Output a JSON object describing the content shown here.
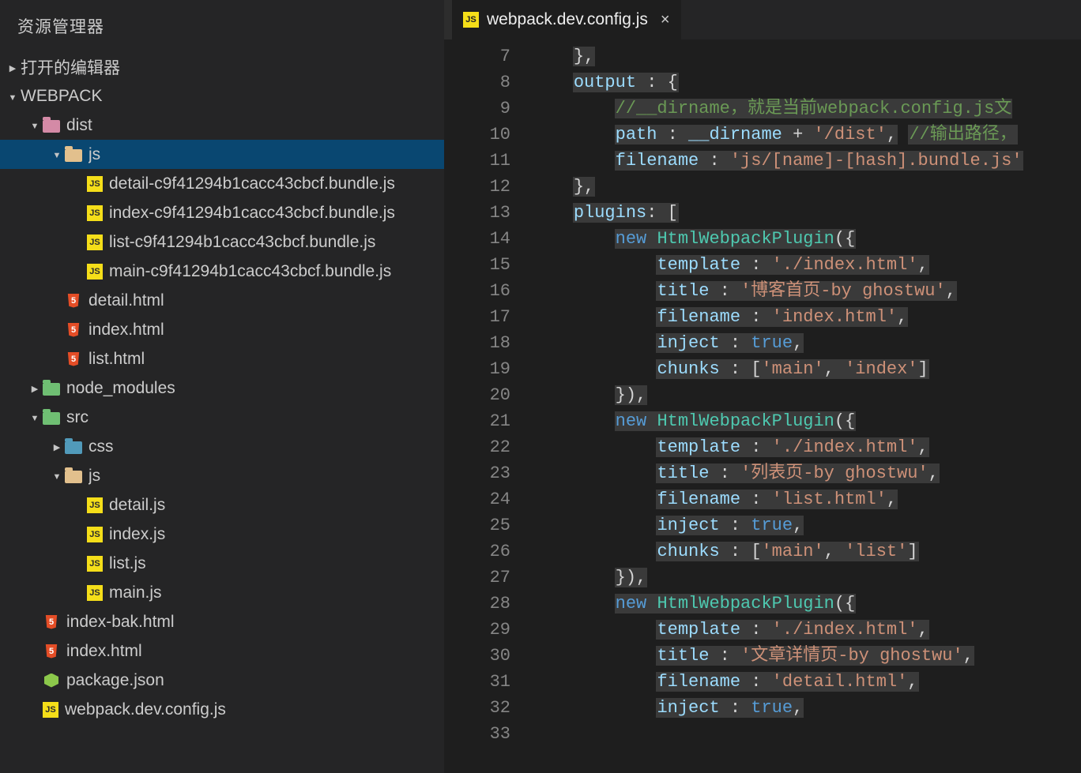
{
  "explorer": {
    "title": "资源管理器",
    "open_editors": "打开的编辑器",
    "project_name": "WEBPACK"
  },
  "tree": [
    {
      "depth": 1,
      "arrow": "expanded",
      "icon": "folder-pink",
      "label": "dist"
    },
    {
      "depth": 2,
      "arrow": "expanded",
      "icon": "folder-yellow",
      "label": "js",
      "selected": true
    },
    {
      "depth": 3,
      "arrow": "",
      "icon": "js",
      "label": "detail-c9f41294b1cacc43cbcf.bundle.js"
    },
    {
      "depth": 3,
      "arrow": "",
      "icon": "js",
      "label": "index-c9f41294b1cacc43cbcf.bundle.js"
    },
    {
      "depth": 3,
      "arrow": "",
      "icon": "js",
      "label": "list-c9f41294b1cacc43cbcf.bundle.js"
    },
    {
      "depth": 3,
      "arrow": "",
      "icon": "js",
      "label": "main-c9f41294b1cacc43cbcf.bundle.js"
    },
    {
      "depth": 2,
      "arrow": "",
      "icon": "html",
      "label": "detail.html"
    },
    {
      "depth": 2,
      "arrow": "",
      "icon": "html",
      "label": "index.html"
    },
    {
      "depth": 2,
      "arrow": "",
      "icon": "html",
      "label": "list.html"
    },
    {
      "depth": 1,
      "arrow": "collapsed",
      "icon": "folder-green",
      "label": "node_modules"
    },
    {
      "depth": 1,
      "arrow": "expanded",
      "icon": "folder-src",
      "label": "src"
    },
    {
      "depth": 2,
      "arrow": "collapsed",
      "icon": "folder-blue",
      "label": "css"
    },
    {
      "depth": 2,
      "arrow": "expanded",
      "icon": "folder-yellow",
      "label": "js"
    },
    {
      "depth": 3,
      "arrow": "",
      "icon": "js",
      "label": "detail.js"
    },
    {
      "depth": 3,
      "arrow": "",
      "icon": "js",
      "label": "index.js"
    },
    {
      "depth": 3,
      "arrow": "",
      "icon": "js",
      "label": "list.js"
    },
    {
      "depth": 3,
      "arrow": "",
      "icon": "js",
      "label": "main.js"
    },
    {
      "depth": 1,
      "arrow": "",
      "icon": "html",
      "label": "index-bak.html"
    },
    {
      "depth": 1,
      "arrow": "",
      "icon": "html",
      "label": "index.html"
    },
    {
      "depth": 1,
      "arrow": "",
      "icon": "node",
      "label": "package.json"
    },
    {
      "depth": 1,
      "arrow": "",
      "icon": "js",
      "label": "webpack.dev.config.js"
    }
  ],
  "tab": {
    "filename": "webpack.dev.config.js"
  },
  "gutter_start": 7,
  "gutter_end": 33,
  "code_lines": [
    [
      [
        "pun",
        "    "
      ],
      [
        "hl pun",
        "},"
      ]
    ],
    [
      [
        "pun",
        "    "
      ],
      [
        "hl",
        [
          [
            "key",
            "output"
          ],
          [
            "pun",
            " "
          ],
          [
            "pun",
            ":"
          ],
          [
            "pun",
            " "
          ],
          [
            "pun",
            "{"
          ]
        ]
      ]
    ],
    [
      [
        "pun",
        "        "
      ],
      [
        "hl com",
        "//__dirname，就是当前webpack.config.js文"
      ]
    ],
    [
      [
        "pun",
        "        "
      ],
      [
        "hl",
        [
          [
            "key",
            "path"
          ],
          [
            "pun",
            " : "
          ],
          [
            "ident",
            "__dirname"
          ],
          [
            "pun",
            " + "
          ],
          [
            "str",
            "'/dist'"
          ],
          [
            "pun",
            ","
          ]
        ]
      ],
      [
        "pun",
        " "
      ],
      [
        "hl com",
        "//输出路径，"
      ]
    ],
    [
      [
        "pun",
        "        "
      ],
      [
        "hl",
        [
          [
            "key",
            "filename"
          ],
          [
            "pun",
            " : "
          ],
          [
            "str",
            "'js/[name]-[hash].bundle.js'"
          ]
        ]
      ]
    ],
    [
      [
        "pun",
        "    "
      ],
      [
        "hl pun",
        "},"
      ]
    ],
    [
      [
        "pun",
        "    "
      ],
      [
        "hl",
        [
          [
            "key",
            "plugins"
          ],
          [
            "pun",
            ":"
          ],
          [
            "pun",
            " ["
          ]
        ]
      ]
    ],
    [
      [
        "pun",
        "        "
      ],
      [
        "hl",
        [
          [
            "kw",
            "new"
          ],
          [
            "pun",
            " "
          ],
          [
            "cls",
            "HtmlWebpackPlugin"
          ],
          [
            "pun",
            "({"
          ]
        ]
      ]
    ],
    [
      [
        "pun",
        "            "
      ],
      [
        "hl",
        [
          [
            "key",
            "template"
          ],
          [
            "pun",
            " : "
          ],
          [
            "str",
            "'./index.html'"
          ],
          [
            "pun",
            ","
          ]
        ]
      ]
    ],
    [
      [
        "pun",
        "            "
      ],
      [
        "hl",
        [
          [
            "key",
            "title"
          ],
          [
            "pun",
            " : "
          ],
          [
            "str",
            "'博客首页-by ghostwu'"
          ],
          [
            "pun",
            ","
          ]
        ]
      ]
    ],
    [
      [
        "pun",
        "            "
      ],
      [
        "hl",
        [
          [
            "key",
            "filename"
          ],
          [
            "pun",
            " : "
          ],
          [
            "str",
            "'index.html'"
          ],
          [
            "pun",
            ","
          ]
        ]
      ]
    ],
    [
      [
        "pun",
        "            "
      ],
      [
        "hl",
        [
          [
            "key",
            "inject"
          ],
          [
            "pun",
            " : "
          ],
          [
            "kw",
            "true"
          ],
          [
            "pun",
            ","
          ]
        ]
      ]
    ],
    [
      [
        "pun",
        "            "
      ],
      [
        "hl",
        [
          [
            "key",
            "chunks"
          ],
          [
            "pun",
            " : ["
          ],
          [
            "str",
            "'main'"
          ],
          [
            "pun",
            ", "
          ],
          [
            "str",
            "'index'"
          ],
          [
            "pun",
            "]"
          ]
        ]
      ]
    ],
    [
      [
        "pun",
        "        "
      ],
      [
        "hl pun",
        "}),"
      ]
    ],
    [
      [
        "pun",
        "        "
      ],
      [
        "hl",
        [
          [
            "kw",
            "new"
          ],
          [
            "pun",
            " "
          ],
          [
            "cls",
            "HtmlWebpackPlugin"
          ],
          [
            "pun",
            "({"
          ]
        ]
      ]
    ],
    [
      [
        "pun",
        "            "
      ],
      [
        "hl",
        [
          [
            "key",
            "template"
          ],
          [
            "pun",
            " : "
          ],
          [
            "str",
            "'./index.html'"
          ],
          [
            "pun",
            ","
          ]
        ]
      ]
    ],
    [
      [
        "pun",
        "            "
      ],
      [
        "hl",
        [
          [
            "key",
            "title"
          ],
          [
            "pun",
            " : "
          ],
          [
            "str",
            "'列表页-by ghostwu'"
          ],
          [
            "pun",
            ","
          ]
        ]
      ]
    ],
    [
      [
        "pun",
        "            "
      ],
      [
        "hl",
        [
          [
            "key",
            "filename"
          ],
          [
            "pun",
            " : "
          ],
          [
            "str",
            "'list.html'"
          ],
          [
            "pun",
            ","
          ]
        ]
      ]
    ],
    [
      [
        "pun",
        "            "
      ],
      [
        "hl",
        [
          [
            "key",
            "inject"
          ],
          [
            "pun",
            " : "
          ],
          [
            "kw",
            "true"
          ],
          [
            "pun",
            ","
          ]
        ]
      ]
    ],
    [
      [
        "pun",
        "            "
      ],
      [
        "hl",
        [
          [
            "key",
            "chunks"
          ],
          [
            "pun",
            " : ["
          ],
          [
            "str",
            "'main'"
          ],
          [
            "pun",
            ", "
          ],
          [
            "str",
            "'list'"
          ],
          [
            "pun",
            "]"
          ]
        ]
      ]
    ],
    [
      [
        "pun",
        "        "
      ],
      [
        "hl pun",
        "}),"
      ]
    ],
    [
      [
        "pun",
        "        "
      ],
      [
        "hl",
        [
          [
            "kw",
            "new"
          ],
          [
            "pun",
            " "
          ],
          [
            "cls",
            "HtmlWebpackPlugin"
          ],
          [
            "pun",
            "({"
          ]
        ]
      ]
    ],
    [
      [
        "pun",
        "            "
      ],
      [
        "hl",
        [
          [
            "key",
            "template"
          ],
          [
            "pun",
            " : "
          ],
          [
            "str",
            "'./index.html'"
          ],
          [
            "pun",
            ","
          ]
        ]
      ]
    ],
    [
      [
        "pun",
        "            "
      ],
      [
        "hl",
        [
          [
            "key",
            "title"
          ],
          [
            "pun",
            " : "
          ],
          [
            "str",
            "'文章详情页-by ghostwu'"
          ],
          [
            "pun",
            ","
          ]
        ]
      ]
    ],
    [
      [
        "pun",
        "            "
      ],
      [
        "hl",
        [
          [
            "key",
            "filename"
          ],
          [
            "pun",
            " : "
          ],
          [
            "str",
            "'detail.html'"
          ],
          [
            "pun",
            ","
          ]
        ]
      ]
    ],
    [
      [
        "pun",
        "            "
      ],
      [
        "hl",
        [
          [
            "key",
            "inject"
          ],
          [
            "pun",
            " : "
          ],
          [
            "kw",
            "true"
          ],
          [
            "pun",
            ","
          ]
        ]
      ]
    ],
    [
      [
        "pun",
        "            "
      ]
    ]
  ]
}
